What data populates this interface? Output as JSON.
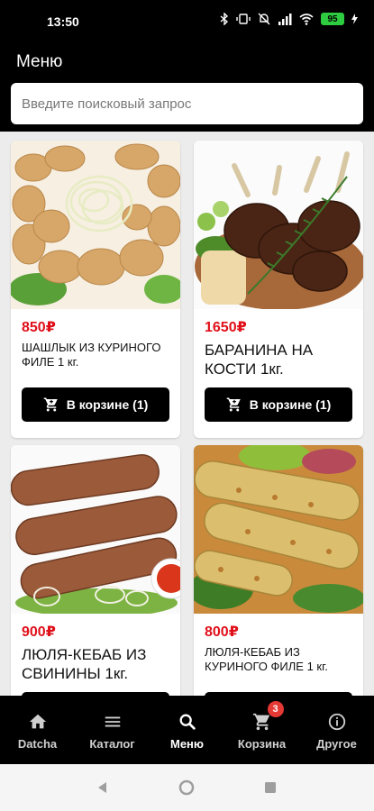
{
  "status": {
    "time": "13:50",
    "battery": "95"
  },
  "header": {
    "title": "Меню"
  },
  "search": {
    "placeholder": "Введите поисковый запрос"
  },
  "products": [
    {
      "price": "850₽",
      "name": "ШАШЛЫК ИЗ КУРИНОГО ФИЛЕ 1 кг.",
      "button": "В корзине (1)"
    },
    {
      "price": "1650₽",
      "name": "БАРАНИНА НА КОСТИ 1кг.",
      "button": "В корзине (1)"
    },
    {
      "price": "900₽",
      "name": "ЛЮЛЯ-КЕБАБ ИЗ СВИНИНЫ 1кг.",
      "button": ""
    },
    {
      "price": "800₽",
      "name": "ЛЮЛЯ-КЕБАБ ИЗ КУРИНОГО ФИЛЕ 1 кг.",
      "button": ""
    }
  ],
  "nav": {
    "items": [
      {
        "label": "Datcha",
        "icon": "home-icon"
      },
      {
        "label": "Каталог",
        "icon": "menu-icon"
      },
      {
        "label": "Меню",
        "icon": "search-icon"
      },
      {
        "label": "Корзина",
        "icon": "cart-icon",
        "badge": "3"
      },
      {
        "label": "Другое",
        "icon": "info-icon"
      }
    ]
  },
  "colors": {
    "price": "#e0101a",
    "accent_bar": "#000000",
    "badge": "#e53935"
  }
}
